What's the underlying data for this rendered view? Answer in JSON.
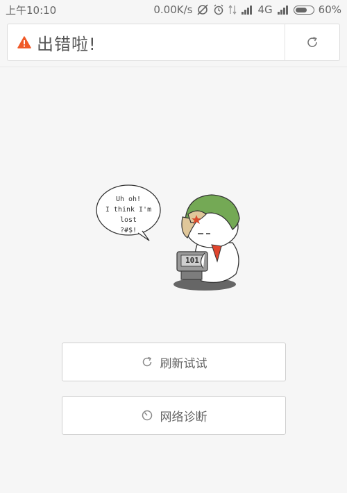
{
  "status_bar": {
    "time": "上午10:10",
    "speed": "0.00K/s",
    "network": "4G",
    "battery": "60%"
  },
  "address_bar": {
    "title": "出错啦!",
    "warning_color": "#f05a28"
  },
  "illustration": {
    "bubble_lines": [
      "Uh oh!",
      "I think I'm lost",
      "?#$!"
    ],
    "screen_text": "101"
  },
  "buttons": {
    "refresh_label": "刷新试试",
    "diagnose_label": "网络诊断"
  }
}
